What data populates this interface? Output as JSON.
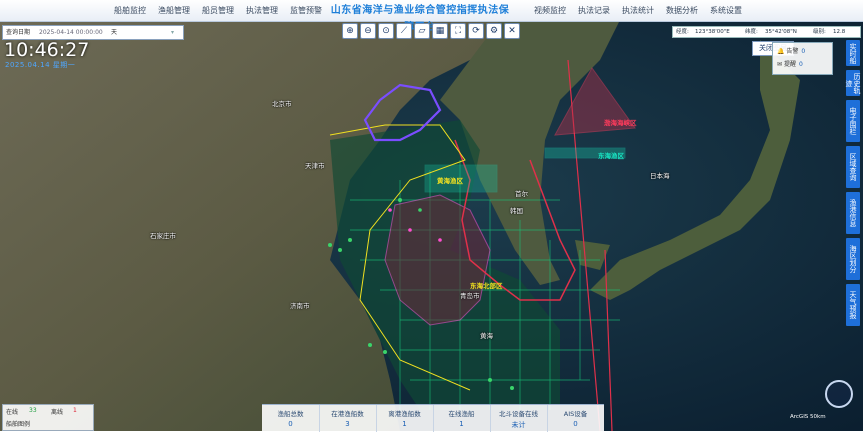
{
  "nav": {
    "left": [
      "船舶监控",
      "渔船管理",
      "船员管理",
      "执法管理",
      "监管预警"
    ],
    "title": "山东省海洋与渔业综合管控指挥执法保障平台",
    "right": [
      "视频监控",
      "执法记录",
      "执法统计",
      "数据分析",
      "系统设置"
    ]
  },
  "filter": {
    "label": "查询日期",
    "value": "2025-04-14 00:00:00",
    "suffix": "天"
  },
  "clock": {
    "time": "10:46:27",
    "date": "2025.04.14 星期一"
  },
  "toolbar": {
    "icons": [
      "zoom-in-icon",
      "zoom-out-icon",
      "fit-icon",
      "measure-line-icon",
      "measure-area-icon",
      "layer-icon",
      "fullscreen-icon",
      "refresh-icon",
      "settings-icon",
      "clear-icon"
    ]
  },
  "coord": {
    "label_lon": "经度:",
    "lon": "123°38'00\"E",
    "label_lat": "纬度:",
    "lat": "35°42'08\"N",
    "label_zoom": "级别:",
    "zoom": "12.8"
  },
  "close_panel": "关闭图层",
  "alerts": [
    {
      "label": "告警",
      "count": "0"
    },
    {
      "label": "提醒",
      "count": "0"
    }
  ],
  "right_buttons": [
    "实时船",
    "历史轨迹",
    "电子围栏",
    "区域查询",
    "渔港信息",
    "海区划分",
    "天气预报"
  ],
  "stats": [
    {
      "label": "渔船总数",
      "value": "0"
    },
    {
      "label": "在港渔船数",
      "value": "3"
    },
    {
      "label": "离港渔船数",
      "value": "1"
    },
    {
      "label": "在线渔船",
      "value": "1"
    },
    {
      "label": "北斗设备在线",
      "value": "未计"
    },
    {
      "label": "AIS设备",
      "value": "0"
    }
  ],
  "legend": {
    "line1_label": "在线",
    "line1_count": "33",
    "line1_alt_label": "离线",
    "line1_alt_count": "1",
    "line2": "船舶图例"
  },
  "map_labels": [
    "北京市",
    "天津市",
    "石家庄市",
    "济南市",
    "青岛市",
    "韩国",
    "首尔",
    "日本海",
    "黄海"
  ],
  "zones": [
    "渤海海峡区",
    "东海渔区",
    "黄海渔区",
    "东海北部区"
  ],
  "scale": "ArcGIS 50km",
  "colors": {
    "accent": "#1e6fd9",
    "title": "#1e7fd8",
    "zone_red": "#e0304a",
    "zone_green": "#18c77a",
    "zone_yellow": "#f0e020"
  }
}
